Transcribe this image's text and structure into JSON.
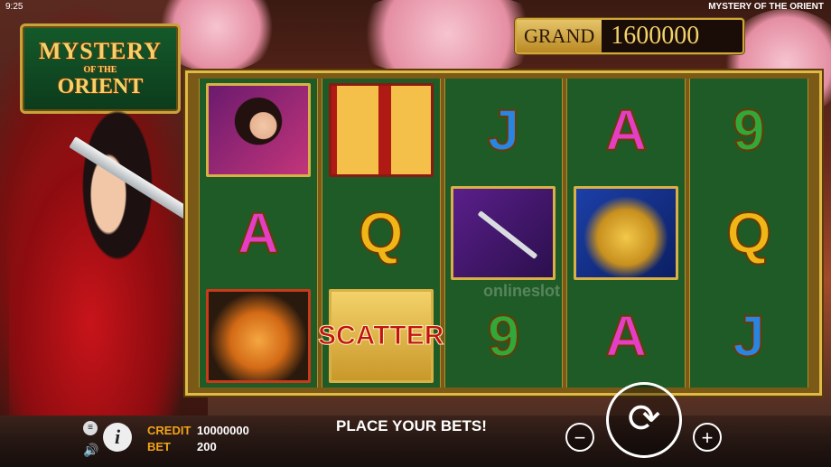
{
  "status": {
    "time": "9:25",
    "game_title": "MYSTERY OF THE ORIENT"
  },
  "logo": {
    "line1": "MYSTERY",
    "line2": "OF THE",
    "line3": "ORIENT"
  },
  "jackpot": {
    "label": "GRAND",
    "value": "1600000"
  },
  "reels": [
    [
      "lady",
      "A",
      "tiger"
    ],
    [
      "lanterns",
      "Q",
      "SCATTER"
    ],
    [
      "J",
      "sword",
      "9"
    ],
    [
      "A",
      "chest",
      "A"
    ],
    [
      "9",
      "Q",
      "J"
    ]
  ],
  "watermark": "onlineslot",
  "bottom": {
    "menu_icon": "≡",
    "sound_icon": "🔊",
    "info": "i",
    "credit_label": "CREDIT",
    "credit_value": "10000000",
    "bet_label": "BET",
    "bet_value": "200",
    "message": "PLACE YOUR BETS!",
    "minus": "−",
    "plus": "+",
    "spin": "⟳"
  },
  "colors": {
    "accent_gold": "#e0b948",
    "reel_green": "#1f5b26",
    "credit_orange": "#f2a31a"
  }
}
